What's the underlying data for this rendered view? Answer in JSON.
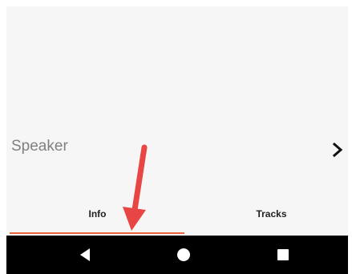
{
  "speaker": {
    "label": "Speaker",
    "chevron_icon": "chevron-right-icon"
  },
  "tabs": [
    {
      "label": "Info",
      "selected": true
    },
    {
      "label": "Tracks",
      "selected": false
    }
  ],
  "nav": {
    "back_icon": "back-triangle-icon",
    "home_icon": "home-circle-icon",
    "recents_icon": "recents-square-icon"
  },
  "annotation": {
    "arrow_icon": "red-arrow-annotation-icon",
    "color": "#e84545"
  },
  "colors": {
    "accent": "#e8643c",
    "background": "#f6f6f6",
    "navbar": "#000000"
  }
}
